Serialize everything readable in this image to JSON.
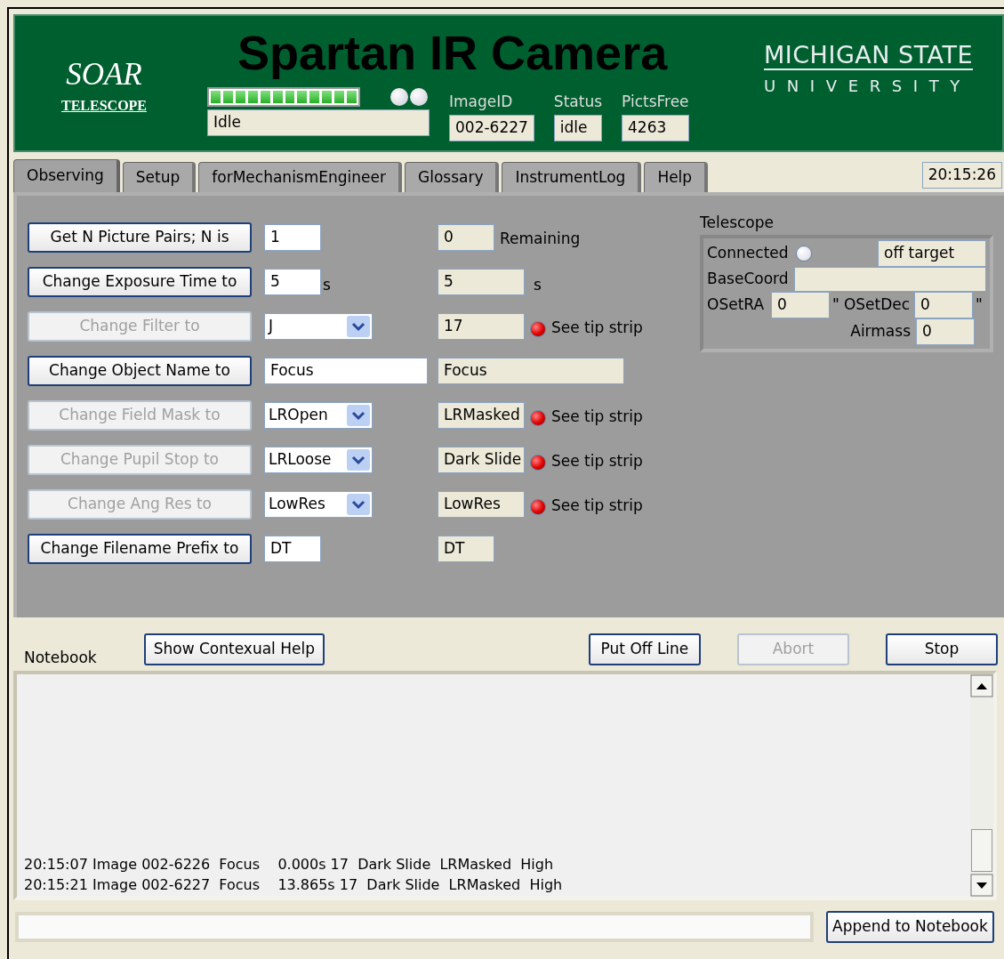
{
  "header": {
    "logo_left": {
      "name": "SOAR",
      "subtitle": "TELESCOPE"
    },
    "title": "Spartan IR Camera",
    "logo_right": {
      "line1": "MICHIGAN STATE",
      "line2": "UNIVERSITY"
    },
    "progress": {
      "level": 1
    },
    "lights": [
      {
        "on": false
      },
      {
        "on": false
      }
    ],
    "state_field": {
      "value": "Idle"
    },
    "fields": [
      {
        "label": "ImageID",
        "value": "002-6227"
      },
      {
        "label": "Status",
        "value": "idle"
      },
      {
        "label": "PictsFree",
        "value": "4263"
      }
    ]
  },
  "tabs": [
    {
      "label": "Observing",
      "selected": true
    },
    {
      "label": "Setup",
      "selected": false
    },
    {
      "label": "forMechanismEngineer",
      "selected": false
    },
    {
      "label": "Glossary",
      "selected": false
    },
    {
      "label": "InstrumentLog",
      "selected": false
    },
    {
      "label": "Help",
      "selected": false
    }
  ],
  "clock": "20:15:26",
  "rows": [
    {
      "button": {
        "label": "Get N Picture Pairs; N is",
        "disabled": false
      },
      "setting": {
        "kind": "short",
        "value": "1"
      },
      "readback": {
        "kind": "short",
        "value": "0",
        "note": "Remaining"
      }
    },
    {
      "button": {
        "label": "Change Exposure Time to",
        "disabled": false
      },
      "setting": {
        "kind": "short",
        "value": "5",
        "unit": "s"
      },
      "readback": {
        "kind": "medium",
        "value": "5",
        "unit": "s"
      }
    },
    {
      "button": {
        "label": "Change Filter to",
        "disabled": true
      },
      "setting": {
        "kind": "dropdown",
        "value": "J"
      },
      "readback": {
        "kind": "medium",
        "value": "17",
        "alert": true,
        "note": "See tip strip"
      }
    },
    {
      "button": {
        "label": "Change Object Name to",
        "disabled": false
      },
      "setting": {
        "kind": "wide",
        "value": "Focus"
      },
      "readback": {
        "kind": "wide",
        "value": "Focus"
      }
    },
    {
      "button": {
        "label": "Change Field Mask to",
        "disabled": true
      },
      "setting": {
        "kind": "dropdown",
        "value": "LROpen"
      },
      "readback": {
        "kind": "medium",
        "value": "LRMasked",
        "alert": true,
        "note": "See tip strip"
      }
    },
    {
      "button": {
        "label": "Change Pupil Stop to",
        "disabled": true
      },
      "setting": {
        "kind": "dropdown",
        "value": "LRLoose"
      },
      "readback": {
        "kind": "medium",
        "value": "Dark Slide",
        "alert": true,
        "note": "See tip strip"
      }
    },
    {
      "button": {
        "label": "Change Ang Res to",
        "disabled": true
      },
      "setting": {
        "kind": "dropdown",
        "value": "LowRes"
      },
      "readback": {
        "kind": "medium",
        "value": "LowRes",
        "alert": true,
        "note": "See tip strip"
      }
    },
    {
      "button": {
        "label": "Change Filename Prefix to",
        "disabled": false
      },
      "setting": {
        "kind": "short",
        "value": "DT"
      },
      "readback": {
        "kind": "short",
        "value": "DT"
      }
    }
  ],
  "telescope": {
    "title": "Telescope",
    "connected_label": "Connected",
    "connected": false,
    "target": "off target",
    "basecoord_label": "BaseCoord",
    "osetra_label": "OSetRA",
    "osetra": "0",
    "osetra_unit": "\"",
    "osetdec_label": "OSetDec",
    "osetdec": "0",
    "osetdec_unit": "\"",
    "airmass_label": "Airmass",
    "airmass": "0"
  },
  "notebook": {
    "label": "Notebook",
    "buttons": [
      {
        "label": "Show Contexual Help",
        "disabled": false
      },
      {
        "label": "Put Off Line",
        "disabled": false
      },
      {
        "label": "Abort",
        "disabled": true
      },
      {
        "label": "Stop",
        "disabled": false
      }
    ],
    "lines": [
      "20:15:07 Image 002-6226  Focus    0.000s 17  Dark Slide  LRMasked  High",
      "20:15:21 Image 002-6227  Focus    13.865s 17  Dark Slide  LRMasked  High"
    ],
    "append_button": "Append to Notebook"
  }
}
